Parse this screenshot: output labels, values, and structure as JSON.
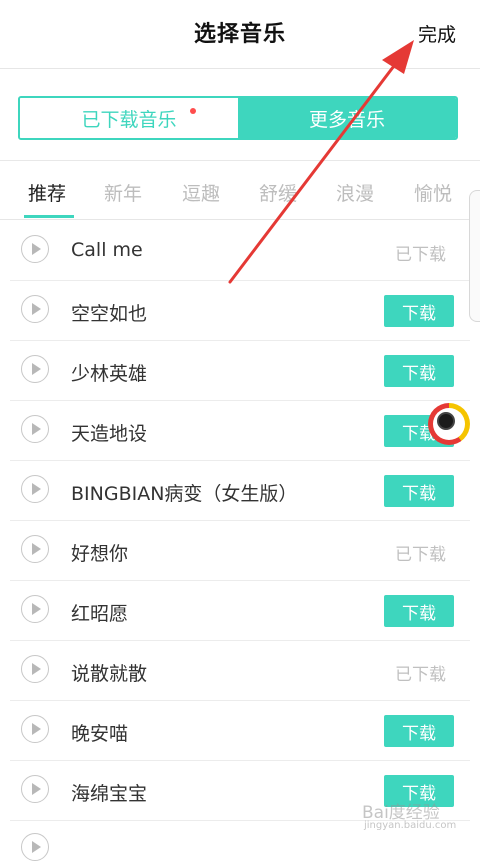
{
  "header": {
    "title": "选择音乐",
    "done_label": "完成"
  },
  "segmented": {
    "left_label": "已下载音乐",
    "right_label": "更多音乐"
  },
  "tabs": [
    {
      "label": "推荐",
      "active": true
    },
    {
      "label": "新年"
    },
    {
      "label": "逗趣"
    },
    {
      "label": "舒缓"
    },
    {
      "label": "浪漫"
    },
    {
      "label": "愉悦"
    }
  ],
  "songs": [
    {
      "name": "Call me",
      "state": "downloaded",
      "label": "已下载"
    },
    {
      "name": "空空如也",
      "state": "download",
      "label": "下载"
    },
    {
      "name": "少林英雄",
      "state": "download",
      "label": "下载"
    },
    {
      "name": "天造地设",
      "state": "download",
      "label": "下载"
    },
    {
      "name": "BINGBIAN病变（女生版）",
      "state": "download",
      "label": "下载"
    },
    {
      "name": "好想你",
      "state": "downloaded",
      "label": "已下载"
    },
    {
      "name": "红昭愿",
      "state": "download",
      "label": "下载"
    },
    {
      "name": "说散就散",
      "state": "downloaded",
      "label": "已下载"
    },
    {
      "name": "晚安喵",
      "state": "download",
      "label": "下载"
    },
    {
      "name": "海绵宝宝",
      "state": "download",
      "label": "下载"
    },
    {
      "name": "",
      "state": "download",
      "label": ""
    }
  ],
  "watermark": {
    "brand": "Bai度经验",
    "url": "jingyan.baidu.com"
  },
  "colors": {
    "accent": "#3ed6be",
    "dot": "#ff4d4d",
    "annotation_arrow": "#e53935"
  },
  "icons": {
    "play": "play-circle-icon",
    "float_widget": "camera-widget-icon"
  }
}
